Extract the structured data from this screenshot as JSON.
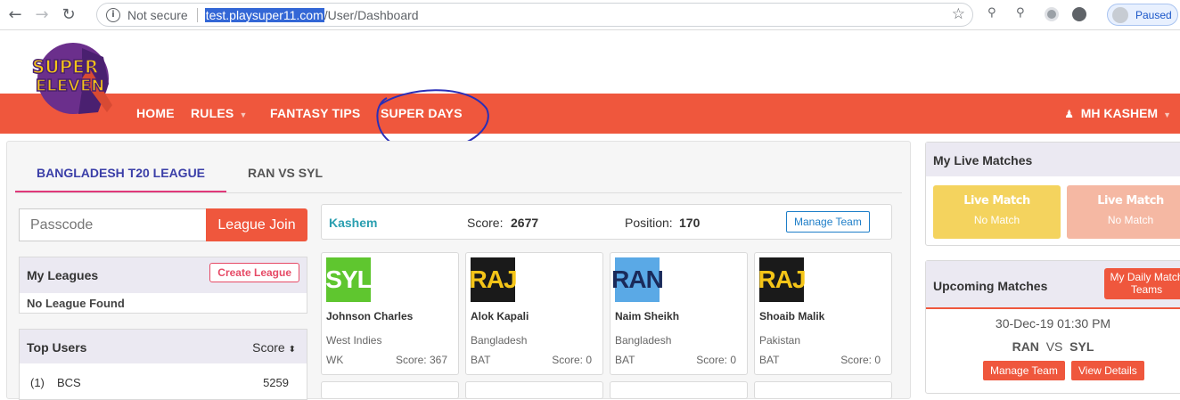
{
  "browser": {
    "security_label": "Not secure",
    "url_host": "test.playsuper11.com",
    "url_path": "/User/Dashboard",
    "profile_status": "Paused"
  },
  "site": {
    "logo_text_top": "SUPER",
    "logo_text_bottom": "ELEVEN",
    "nav": [
      "HOME",
      "RULES",
      "FANTASY TIPS",
      "SUPER DAYS"
    ],
    "user_name": "MH KASHEM",
    "colors": {
      "brand_orange": "#ef573d",
      "tab_active": "#3b3fa8",
      "tab_underline": "#e0397a",
      "live_yellow": "#f4d35e",
      "live_peach": "#f5b8a3"
    }
  },
  "tabs": [
    "BANGLADESH T20 LEAGUE",
    "RAN VS SYL"
  ],
  "league": {
    "passcode_placeholder": "Passcode",
    "join_label": "League Join",
    "my_leagues_title": "My Leagues",
    "create_label": "Create League",
    "empty_text": "No League Found"
  },
  "top_users": {
    "title": "Top Users",
    "score_header": "Score",
    "rows": [
      {
        "rank": "(1)",
        "name": "BCS",
        "score": "5259"
      }
    ]
  },
  "team_summary": {
    "team_name": "Kashem",
    "score_label": "Score:",
    "score_value": "2677",
    "position_label": "Position:",
    "position_value": "170",
    "manage_label": "Manage Team"
  },
  "players": [
    {
      "team": "SYL",
      "name": "Johnson Charles",
      "country": "West Indies",
      "role": "WK",
      "score": "Score: 367"
    },
    {
      "team": "RAJ",
      "name": "Alok Kapali",
      "country": "Bangladesh",
      "role": "BAT",
      "score": "Score: 0"
    },
    {
      "team": "RAN",
      "name": "Naim Sheikh",
      "country": "Bangladesh",
      "role": "BAT",
      "score": "Score: 0"
    },
    {
      "team": "RAJ",
      "name": "Shoaib Malik",
      "country": "Pakistan",
      "role": "BAT",
      "score": "Score: 0"
    }
  ],
  "live_matches": {
    "title": "My Live Matches",
    "cards": [
      {
        "title": "Live Match",
        "sub": "No Match"
      },
      {
        "title": "Live Match",
        "sub": "No Match"
      }
    ]
  },
  "upcoming": {
    "title": "Upcoming Matches",
    "daily_btn": "My Daily Match Teams",
    "datetime": "30-Dec-19 01:30 PM",
    "team_a": "RAN",
    "vs": "VS",
    "team_b": "SYL",
    "manage_label": "Manage Team",
    "details_label": "View Details"
  }
}
